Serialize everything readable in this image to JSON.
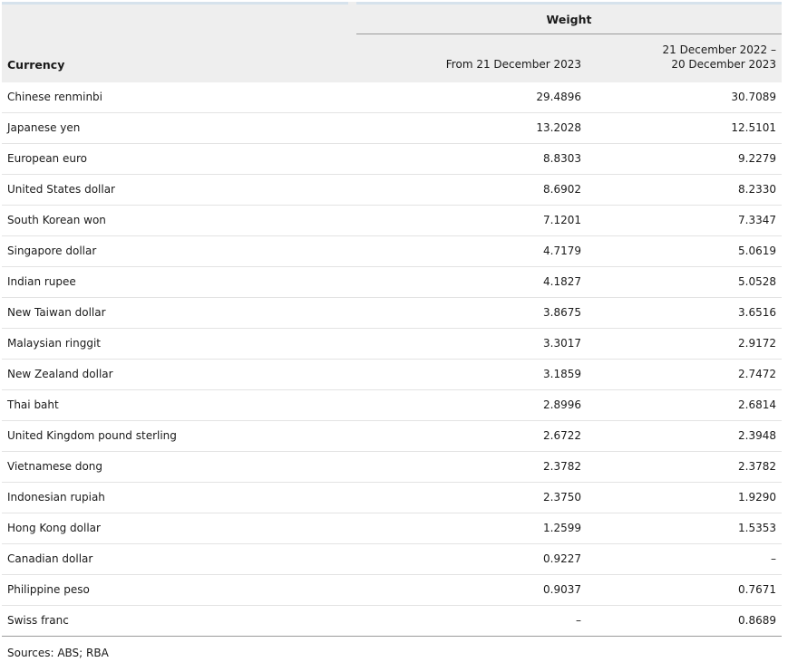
{
  "table": {
    "weight_header": "Weight",
    "columns": {
      "currency": "Currency",
      "col1": "From 21 December 2023",
      "col2_line1": "21 December 2022 –",
      "col2_line2": "20 December 2023"
    },
    "rows": [
      {
        "currency": "Chinese renminbi",
        "from_2023": "29.4896",
        "prev": "30.7089"
      },
      {
        "currency": "Japanese yen",
        "from_2023": "13.2028",
        "prev": "12.5101"
      },
      {
        "currency": "European euro",
        "from_2023": "8.8303",
        "prev": "9.2279"
      },
      {
        "currency": "United States dollar",
        "from_2023": "8.6902",
        "prev": "8.2330"
      },
      {
        "currency": "South Korean won",
        "from_2023": "7.1201",
        "prev": "7.3347"
      },
      {
        "currency": "Singapore dollar",
        "from_2023": "4.7179",
        "prev": "5.0619"
      },
      {
        "currency": "Indian rupee",
        "from_2023": "4.1827",
        "prev": "5.0528"
      },
      {
        "currency": "New Taiwan dollar",
        "from_2023": "3.8675",
        "prev": "3.6516"
      },
      {
        "currency": "Malaysian ringgit",
        "from_2023": "3.3017",
        "prev": "2.9172"
      },
      {
        "currency": "New Zealand dollar",
        "from_2023": "3.1859",
        "prev": "2.7472"
      },
      {
        "currency": "Thai baht",
        "from_2023": "2.8996",
        "prev": "2.6814"
      },
      {
        "currency": "United Kingdom pound sterling",
        "from_2023": "2.6722",
        "prev": "2.3948"
      },
      {
        "currency": "Vietnamese dong",
        "from_2023": "2.3782",
        "prev": "2.3782"
      },
      {
        "currency": "Indonesian rupiah",
        "from_2023": "2.3750",
        "prev": "1.9290"
      },
      {
        "currency": "Hong Kong dollar",
        "from_2023": "1.2599",
        "prev": "1.5353"
      },
      {
        "currency": "Canadian dollar",
        "from_2023": "0.9227",
        "prev": "–"
      },
      {
        "currency": "Philippine peso",
        "from_2023": "0.9037",
        "prev": "0.7671"
      },
      {
        "currency": "Swiss franc",
        "from_2023": "–",
        "prev": "0.8689"
      }
    ]
  },
  "footer": {
    "sources": "Sources: ABS; RBA"
  }
}
